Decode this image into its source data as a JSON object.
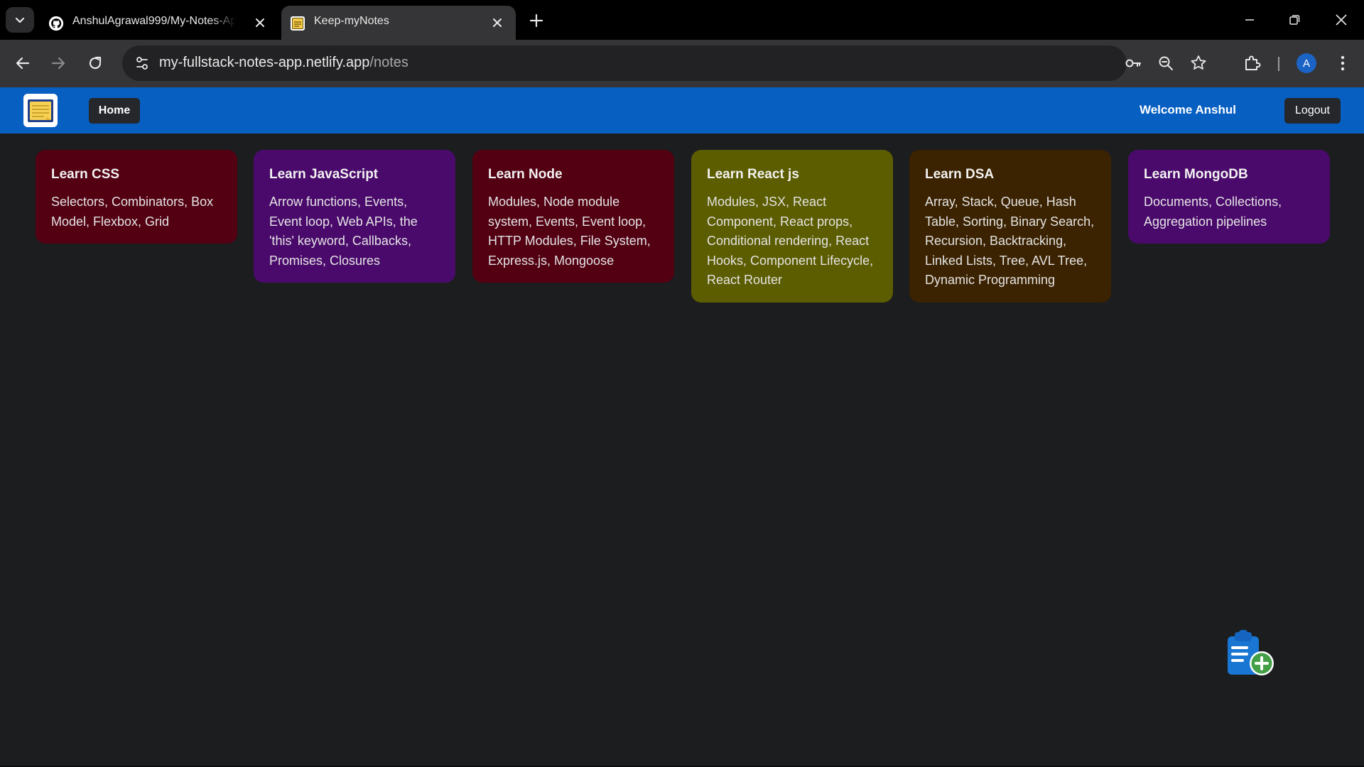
{
  "browser": {
    "tabs": [
      {
        "title": "AnshulAgrawal999/My-Notes-App",
        "active": false,
        "favicon": "github-icon"
      },
      {
        "title": "Keep-myNotes",
        "active": true,
        "favicon": "notes-favicon"
      }
    ],
    "url_host": "my-fullstack-notes-app.netlify.app",
    "url_path": "/notes",
    "profile_initial": "A"
  },
  "navbar": {
    "home_label": "Home",
    "welcome_text": "Welcome Anshul",
    "logout_label": "Logout",
    "bg_color": "#075fc2"
  },
  "notes": [
    {
      "title": "Learn CSS",
      "content": "Selectors, Combinators, Box Model, Flexbox, Grid",
      "color": "#520012"
    },
    {
      "title": "Learn JavaScript",
      "content": "Arrow functions, Events, Event loop, Web APIs, the 'this' keyword, Callbacks, Promises, Closures",
      "color": "#4a0a6b"
    },
    {
      "title": "Learn Node",
      "content": "Modules, Node module system, Events, Event loop, HTTP Modules, File System, Express.js, Mongoose",
      "color": "#520012"
    },
    {
      "title": "Learn React js",
      "content": "Modules, JSX, React Component, React props, Conditional rendering, React Hooks, Component Lifecycle, React Router",
      "color": "#5c5c00"
    },
    {
      "title": "Learn DSA",
      "content": "Array, Stack, Queue, Hash Table, Sorting, Binary Search, Recursion, Backtracking, Linked Lists, Tree, AVL Tree, Dynamic Programming",
      "color": "#3b2200"
    },
    {
      "title": "Learn MongoDB",
      "content": "Documents, Collections, Aggregation pipelines",
      "color": "#4a0a6b"
    }
  ],
  "add_note_icon": "add-note-icon"
}
